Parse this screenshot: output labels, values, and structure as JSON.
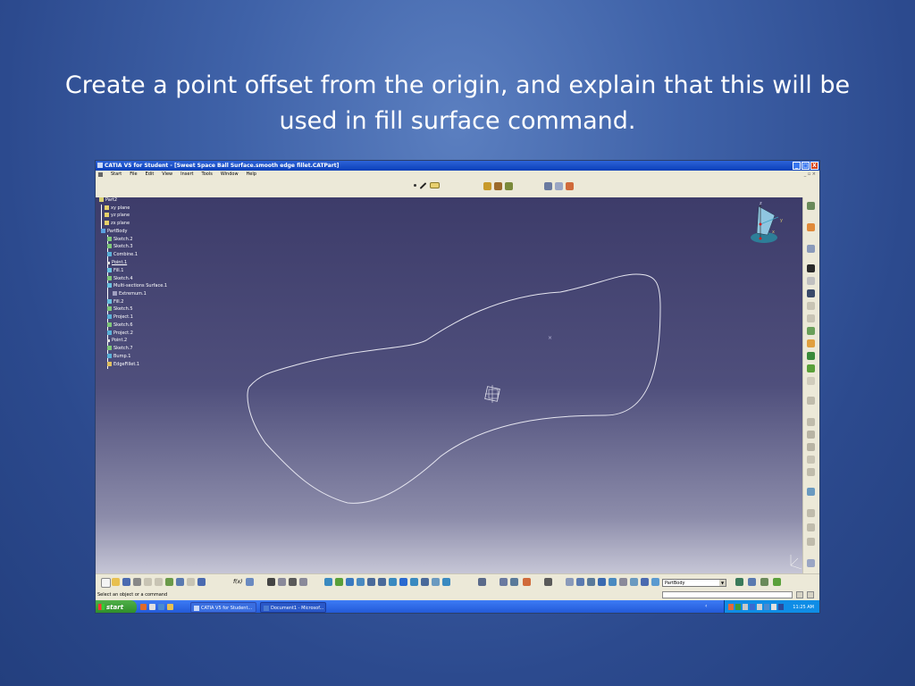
{
  "slide": {
    "title_line1": "Create a point offset from the origin, and explain that this will be",
    "title_line2": "used in fill surface command."
  },
  "window": {
    "title": "CATIA V5 for Student - [Sweet Space Ball Surface.smooth edge fillet.CATPart]",
    "minimize": "_",
    "maximize": "□",
    "close": "X"
  },
  "menu": {
    "items": [
      "Start",
      "File",
      "Edit",
      "View",
      "Insert",
      "Tools",
      "Window",
      "Help"
    ],
    "mdi_controls": "_ ▫ ×"
  },
  "tree": {
    "items": [
      "Part2",
      "xy plane",
      "yz plane",
      "zx plane",
      "PartBody",
      "Sketch.2",
      "Sketch.3",
      "Combine.1",
      "Point.1",
      "Fill.1",
      "Sketch.4",
      "Multi-sections Surface.1",
      "Extremum.1",
      "Fill.2",
      "Sketch.5",
      "Project.1",
      "Sketch.6",
      "Project.2",
      "Point.2",
      "Sketch.7",
      "Bump.1",
      "EdgeFillet.1"
    ]
  },
  "compass_labels": {
    "z": "z",
    "y": "y",
    "x": "x"
  },
  "toolbar": {
    "current_body": "PartBody",
    "formula_label": "f(x)"
  },
  "status": {
    "message": "Select an object or a command"
  },
  "taskbar": {
    "start_label": "start",
    "tasks": [
      "CATIA V5 for Student...",
      "Document1 - Microsof..."
    ],
    "clock": "11:25 AM"
  },
  "colors": {
    "slide_bg": "#3f62a8",
    "viewport_top": "#3d3c6a",
    "viewport_bottom": "#c6c6d6",
    "curve": "#e6e6f0",
    "tree_text": "#ffffff",
    "xp_taskbar": "#1f55d4",
    "xp_start": "#2b8a26"
  },
  "icons": {
    "viewport": [
      "compass-icon",
      "point-marker-icon",
      "origin-axis-icon",
      "catia-logo-icon"
    ],
    "tree": [
      "part-icon",
      "plane-icon",
      "body-icon",
      "sketch-icon",
      "feature-icon"
    ]
  }
}
